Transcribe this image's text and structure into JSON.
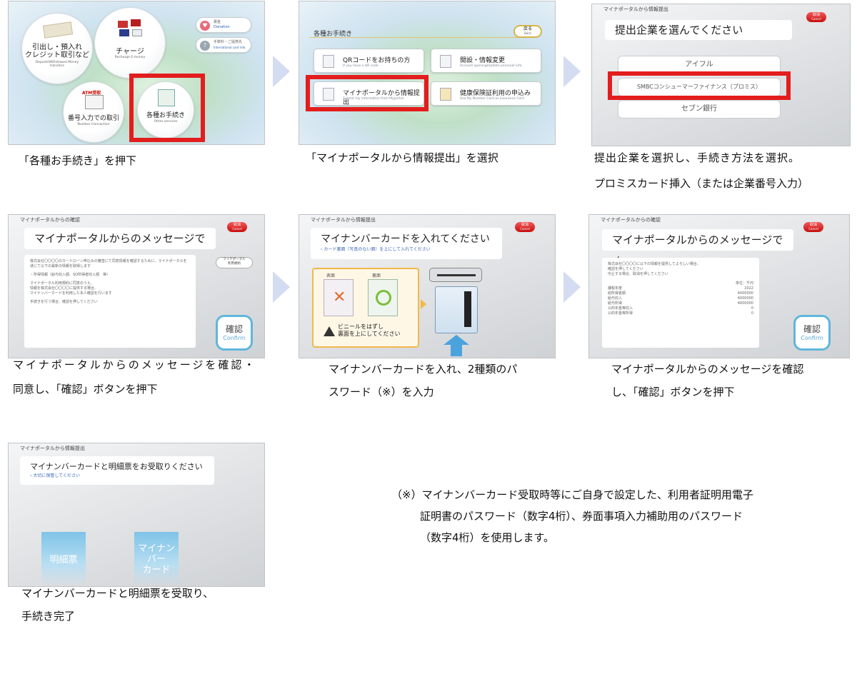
{
  "colors": {
    "highlight": "#e31d1d",
    "confirm_border": "#5fb6dc",
    "arrow": "#d3dcf0",
    "cancel": "#d91414"
  },
  "step1": {
    "circles": [
      {
        "label": "引出し・預入れ\nクレジット取引など",
        "sub": "Deposit/Withdrawal Money transfers"
      },
      {
        "label": "チャージ",
        "sub": "Recharge E-money"
      },
      {
        "label": "番号入力での取引",
        "sub": "Number transaction",
        "badge": "ATM受取"
      },
      {
        "label": "各種お手続き",
        "sub": "Other services"
      }
    ],
    "pills": [
      {
        "label": "募金",
        "sub": "Donation"
      },
      {
        "label": "手数料・ご提携先",
        "sub": "International card info."
      }
    ],
    "caption": "「各種お手続き」を押下"
  },
  "step2": {
    "title": "各種お手続き",
    "back": "戻る",
    "back_sub": "Back",
    "options": [
      {
        "label": "QRコードをお持ちの方",
        "sub": "If you have a QR code"
      },
      {
        "label": "開設・情報変更",
        "sub": "Account opening/Update personal info."
      },
      {
        "label": "マイナポータルから情報提出",
        "sub": "Submit my information from Myportal"
      },
      {
        "label": "健康保険証利用の申込み",
        "sub": "Use My Number Card as insurance Card"
      }
    ],
    "caption": "「マイナポータルから情報提出」を選択"
  },
  "step3": {
    "header": "マイナポータルから情報提出",
    "cancel": "取消",
    "cancel_sub": "Cancel",
    "title": "提出企業を選んでください",
    "companies": [
      "アイフル",
      "SMBCコンシューマーファイナンス（プロミス）",
      "セブン銀行"
    ],
    "caption_line1": "提出企業を選択し、手続き方法を選択。",
    "caption_line2": "プロミスカード挿入（または企業番号入力）"
  },
  "step4": {
    "header": "マイナポータルからの確認",
    "cancel": "取消",
    "cancel_sub": "Cancel",
    "title": "マイナポータルからのメッセージです",
    "body": [
      "株式会社〇〇〇〇のカードローン申込みの審査にて同意情報を確認するために、マイナポータルを通じて以下の最新の情報を取得します",
      "",
      "・所得情報（給与収入額、SO所得者収入額　等）",
      "",
      "マイナポータル利用規約に同意のうえ、",
      "情報を株式会社〇〇〇〇に提供する場合、",
      "マイナンバーカードを利用した本人確認を行います",
      "",
      "手続きを行う場合、確認を押してください"
    ],
    "side_button": "マイナポータル\n利用規約",
    "confirm": "確認",
    "confirm_sub": "Confirm",
    "caption_line1": "マイナポータルからのメッセージを確認・",
    "caption_line2": "同意し、「確認」ボタンを押下"
  },
  "step5": {
    "header": "マイナポータルから情報提出",
    "cancel": "取消",
    "cancel_sub": "Cancel",
    "title": "マイナンバーカードを入れてください",
    "subtitle": "カード裏面（写真のない面）を上にして入れてください",
    "front": "表面",
    "back": "裏面",
    "warning": "ビニールをはずし\n裏面を上にしてください",
    "caption_line1": "マイナンバーカードを入れ、2種類のパ",
    "caption_line2": "スワード（※）を入力"
  },
  "step6": {
    "header": "マイナポータルからの確認",
    "cancel": "取消",
    "cancel_sub": "Cancel",
    "title": "マイナポータルからのメッセージです",
    "body": [
      "株式会社〇〇〇〇に以下の情報を提供してよろしい場合、",
      "確認を押してください",
      "中止する場合、取消を押してください"
    ],
    "table_header": "単位：千円",
    "rows": [
      [
        "課税年度",
        "2022"
      ],
      [
        "総所得金額",
        "4000000"
      ],
      [
        "給与収入",
        "4000000"
      ],
      [
        "給与所得",
        "4000000"
      ],
      [
        "公的年金等収入",
        "0"
      ],
      [
        "公的年金等所得",
        "0"
      ]
    ],
    "confirm": "確認",
    "confirm_sub": "Confirm",
    "caption_line1": "マイナポータルからのメッセージを確認",
    "caption_line2": "し、「確認」ボタンを押下"
  },
  "step7": {
    "header": "マイナポータルから情報提出",
    "title": "マイナンバーカードと明細票をお受取りください",
    "subtitle": "大切に保管してください",
    "receipt": "明細票",
    "card": "マイナンバー\nカード",
    "caption_line1": "マイナンバーカードと明細票を受取り、",
    "caption_line2": "手続き完了"
  },
  "note": {
    "line1": "（※）マイナンバーカード受取時等にご自身で設定した、利用者証明用電子",
    "line2": "証明書のパスワード（数字4桁）、券面事項入力補助用のパスワード",
    "line3": "（数字4桁）を使用します。"
  }
}
